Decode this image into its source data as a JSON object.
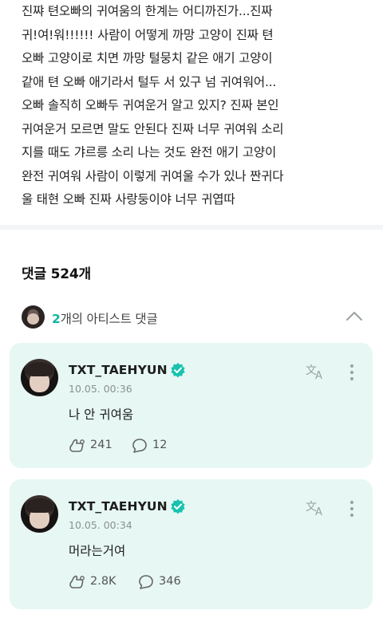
{
  "post": {
    "body": "진쨔 텬오빠의 귀여움의 한계는 어디까진가...진짜\n귀!여!워!!!!!! 사람이 어떻게 까망 고양이 진짜 텬\n오빠 고양이로 치면 까망 털뭉치 같은 애기 고양이\n같애 텬 오빠 애기라서 털두 서 있구 넘 귀여워어...\n오빠 솔직히 오빠두 귀여운거 알고 있지? 진짜 본인\n귀여운거 모르면 말도 안된다 진짜 너무 귀여워 소리\n지를 때도 갸르릉 소리 나는 것도 완전 애기 고양이\n완전 귀여워 사람이 이렇게 귀여울 수가 있나 짠귀다\n울 태현 오빠 진짜 사랑둥이야 너무 귀엽따"
  },
  "comments": {
    "header": "댓글 524개",
    "artist_bar": {
      "count": "2",
      "label_suffix": "개의 아티스트 댓글",
      "collapse_icon": "chevron-up-icon"
    },
    "items": [
      {
        "name": "TXT_TAEHYUN",
        "date": "10.05. 00:36",
        "text": "나 안 귀여움",
        "likes": "241",
        "replies": "12"
      },
      {
        "name": "TXT_TAEHYUN",
        "date": "10.05. 00:34",
        "text": "머라는거여",
        "likes": "2.8K",
        "replies": "346"
      }
    ]
  },
  "colors": {
    "accent": "#12b5a4",
    "card_background": "#e6f7f4",
    "verified": "#18c2ae"
  },
  "icons": {
    "verified": "verified-badge-icon",
    "translate": "translate-icon",
    "more": "more-vertical-icon",
    "like": "like-icon",
    "reply": "reply-bubble-icon"
  }
}
